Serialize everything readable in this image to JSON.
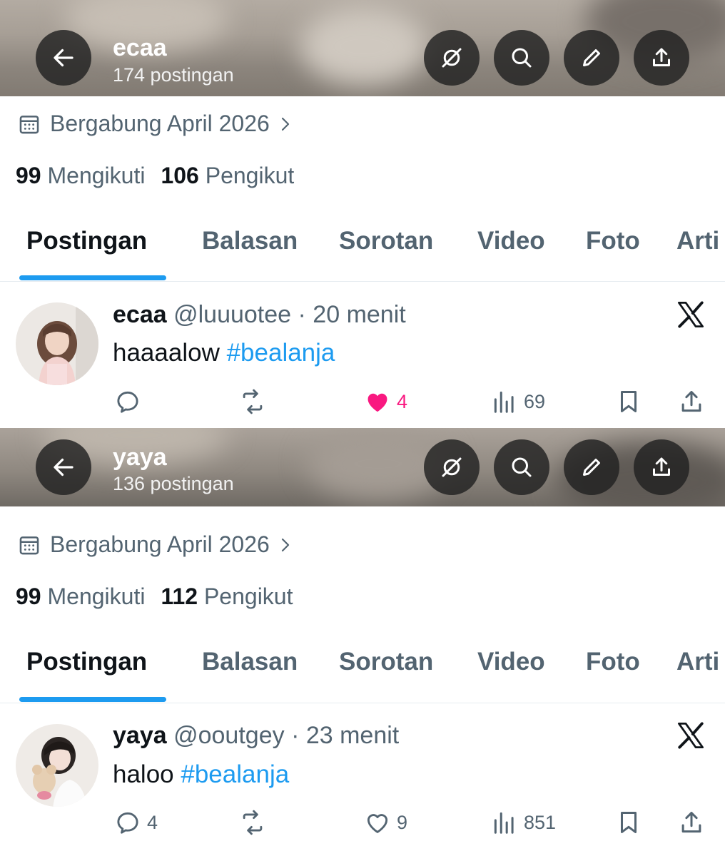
{
  "profiles": [
    {
      "header": {
        "name": "ecaa",
        "posts_count": "174 postingan"
      },
      "joined": "Bergabung April 2026",
      "following_count": "99",
      "following_label": "Mengikuti",
      "followers_count": "106",
      "followers_label": "Pengikut",
      "tabs": [
        "Postingan",
        "Balasan",
        "Sorotan",
        "Video",
        "Foto",
        "Arti"
      ],
      "post": {
        "name": "ecaa",
        "handle": "@luuuotee",
        "time": "· 20 menit",
        "text": "haaaalow",
        "hashtag": "#bealanja",
        "replies": "",
        "reposts": "",
        "likes": "4",
        "views": "69",
        "liked": true
      }
    },
    {
      "header": {
        "name": "yaya",
        "posts_count": "136 postingan"
      },
      "joined": "Bergabung April 2026",
      "following_count": "99",
      "following_label": "Mengikuti",
      "followers_count": "112",
      "followers_label": "Pengikut",
      "tabs": [
        "Postingan",
        "Balasan",
        "Sorotan",
        "Video",
        "Foto",
        "Arti"
      ],
      "post": {
        "name": "yaya",
        "handle": "@ooutgey",
        "time": "· 23 menit",
        "text": "haloo",
        "hashtag": "#bealanja",
        "replies": "4",
        "reposts": "",
        "likes": "9",
        "views": "851",
        "liked": false
      }
    }
  ],
  "colors": {
    "accent": "#1d9bf0",
    "like": "#f91880",
    "muted": "#536471",
    "text": "#0f1419"
  },
  "icons": [
    "back-arrow-icon",
    "eye-off-icon",
    "search-icon",
    "pencil-icon",
    "share-icon",
    "calendar-icon",
    "chevron-right-icon",
    "x-logo-icon",
    "reply-icon",
    "repost-icon",
    "heart-icon",
    "views-icon",
    "bookmark-icon"
  ]
}
